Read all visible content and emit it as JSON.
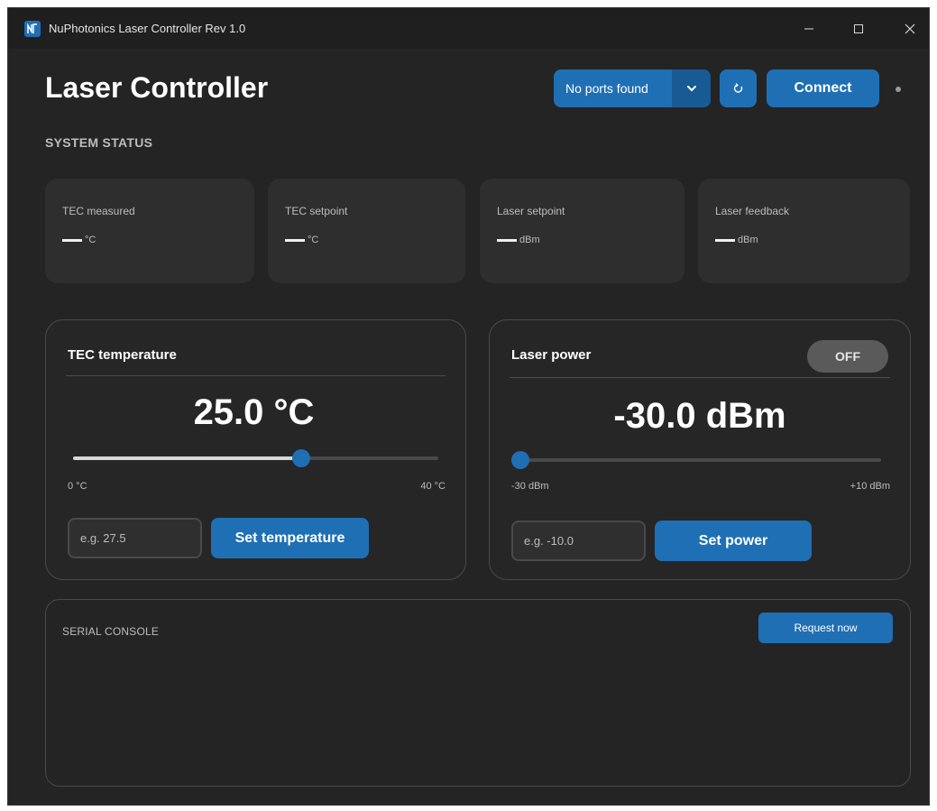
{
  "window": {
    "title": "NuPhotonics Laser Controller Rev 1.0",
    "minimize_label": "—",
    "maximize_label": "□",
    "close_label": "✕"
  },
  "header": {
    "title": "Laser Controller",
    "port_select": {
      "value": "No ports found"
    },
    "connect_label": "Connect"
  },
  "status": {
    "section_label": "SYSTEM STATUS",
    "cards": [
      {
        "label": "TEC measured",
        "unit": "°C"
      },
      {
        "label": "TEC setpoint",
        "unit": "°C"
      },
      {
        "label": "Laser setpoint",
        "unit": "dBm"
      },
      {
        "label": "Laser feedback",
        "unit": "dBm"
      }
    ]
  },
  "tec": {
    "title": "TEC temperature",
    "value": "25.0 °C",
    "slider_fraction": 0.625,
    "min_label": "0 °C",
    "max_label": "40 °C",
    "input_placeholder": "e.g. 27.5",
    "button_label": "Set temperature"
  },
  "laser": {
    "title": "Laser power",
    "toggle_label": "OFF",
    "value": "-30.0 dBm",
    "slider_fraction": 0.0,
    "min_label": "-30 dBm",
    "max_label": "+10 dBm",
    "input_placeholder": "e.g. -10.0",
    "button_label": "Set power"
  },
  "console": {
    "label": "SERIAL CONSOLE",
    "request_label": "Request now"
  },
  "colors": {
    "accent": "#1f6fb5",
    "background": "#242424",
    "card": "#2e2e2e",
    "toggle_off": "#5a5a5a"
  }
}
